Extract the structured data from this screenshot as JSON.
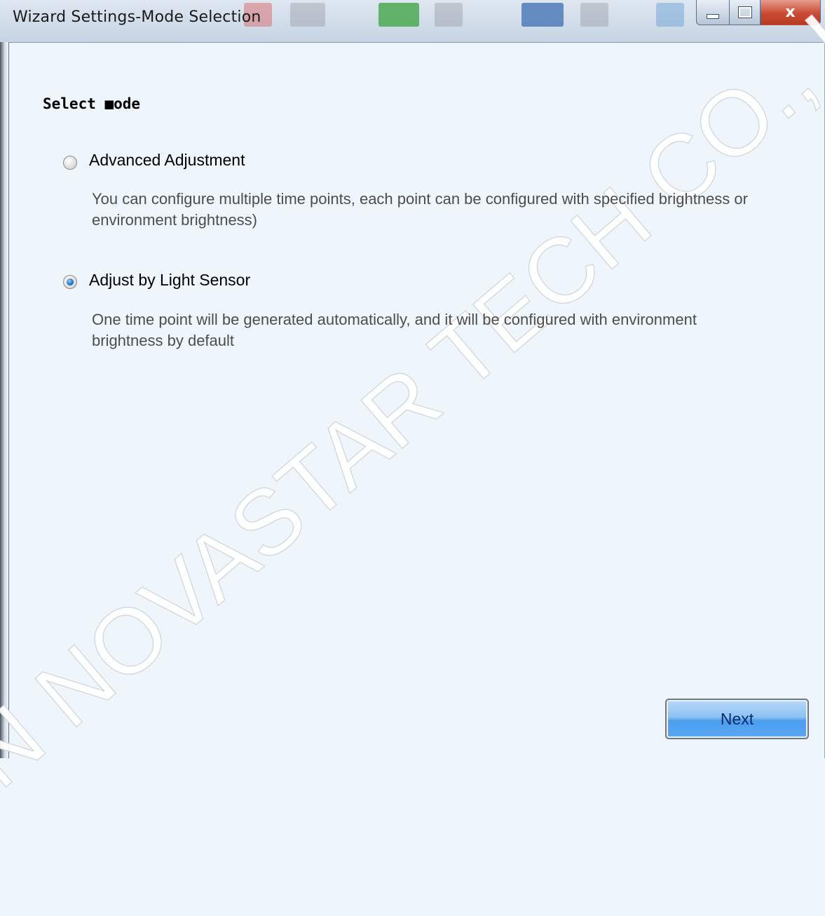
{
  "window": {
    "title": "Wizard Settings-Mode Selection",
    "close_glyph": "x"
  },
  "section": {
    "title": "Select ■ode"
  },
  "options": [
    {
      "label": "Advanced Adjustment",
      "description": "You can configure multiple time points, each point can be configured with specified brightness or environment brightness)",
      "selected": false
    },
    {
      "label": "Adjust by Light Sensor",
      "description": "One time point will be generated automatically, and it will be configured with environment brightness by default",
      "selected": true
    }
  ],
  "watermark": "XI'AN NOVASTAR TECH CO., LTD.",
  "buttons": {
    "next_label": "Next"
  },
  "colors": {
    "background": "#eef5fb",
    "next_button": "#5aa8f3",
    "close_button": "#c94b34"
  },
  "icons": [
    "minimize-icon",
    "maximize-icon",
    "close-icon",
    "radio-unchecked-icon",
    "radio-checked-icon"
  ]
}
